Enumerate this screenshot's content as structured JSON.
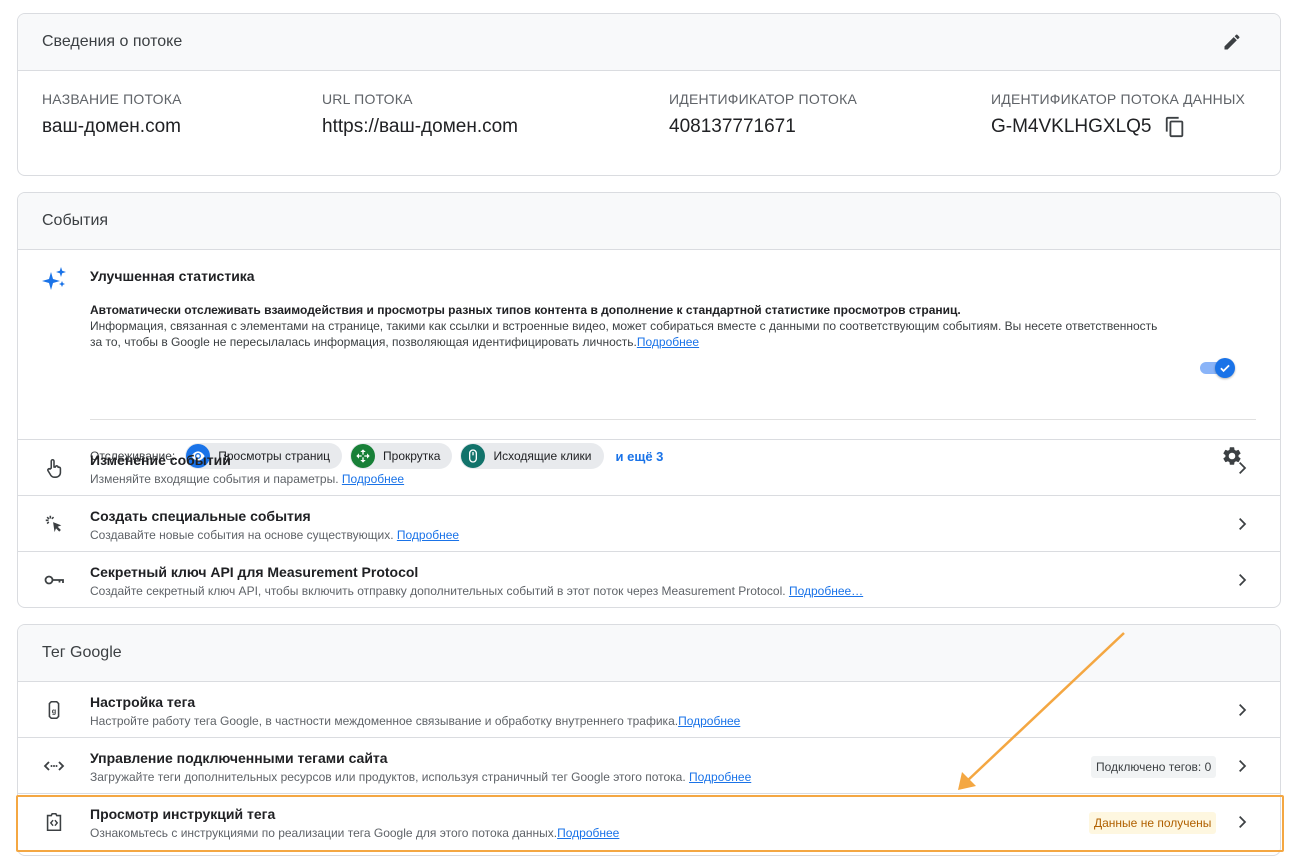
{
  "stream": {
    "title": "Сведения о потоке",
    "fields": [
      {
        "label": "НАЗВАНИЕ ПОТОКА",
        "value": "ваш-домен.com"
      },
      {
        "label": "URL ПОТОКА",
        "value": "https://ваш-домен.com"
      },
      {
        "label": "ИДЕНТИФИКАТОР ПОТОКА",
        "value": "408137771671"
      },
      {
        "label": "ИДЕНТИФИКАТОР ПОТОКА ДАННЫХ",
        "value": "G-M4VKLHGXLQ5"
      }
    ]
  },
  "events": {
    "title": "События",
    "enhanced": {
      "title": "Улучшенная статистика",
      "bold_text": "Автоматически отслеживать взаимодействия и просмотры разных типов контента в дополнение к стандартной статистике просмотров страниц.",
      "text": "Информация, связанная с элементами на странице, такими как ссылки и встроенные видео, может собираться вместе с данными по соответствующим событиям. Вы несете ответственность за то, чтобы в Google не пересылалась информация, позволяющая идентифицировать личность.",
      "link": "Подробнее",
      "toggle_on": true,
      "tracking_label": "Отслеживание:",
      "chips": [
        {
          "label": "Просмотры страниц",
          "color": "#1a73e8"
        },
        {
          "label": "Прокрутка",
          "color": "#188038"
        },
        {
          "label": "Исходящие клики",
          "color": "#12736b"
        }
      ],
      "more": "и ещё 3"
    },
    "rows": [
      {
        "title": "Изменение событий",
        "desc": "Изменяйте входящие события и параметры. ",
        "link": "Подробнее"
      },
      {
        "title": "Создать специальные события",
        "desc": "Создавайте новые события на основе существующих. ",
        "link": "Подробнее"
      },
      {
        "title": "Секретный ключ API для Measurement Protocol",
        "desc": "Создайте секретный ключ API, чтобы включить отправку дополнительных событий в этот поток через Measurement Protocol. ",
        "link": "Подробнее…"
      }
    ]
  },
  "tag": {
    "title": "Тег Google",
    "rows": [
      {
        "title": "Настройка тега",
        "desc": "Настройте работу тега Google, в частности междоменное связывание и обработку внутреннего трафика.",
        "link": "Подробнее"
      },
      {
        "title": "Управление подключенными тегами сайта",
        "desc": "Загружайте теги дополнительных ресурсов или продуктов, используя страничный тег Google этого потока. ",
        "link": "Подробнее",
        "badge": "Подключено тегов: 0"
      },
      {
        "title": "Просмотр инструкций тега",
        "desc": "Ознакомьтесь с инструкциями по реализации тега Google для этого потока данных.",
        "link": "Подробнее",
        "badge": "Данные не получены"
      }
    ]
  },
  "colors": {
    "accent": "#1a73e8",
    "highlight": "#f4a742",
    "warning_text": "#b06000"
  }
}
